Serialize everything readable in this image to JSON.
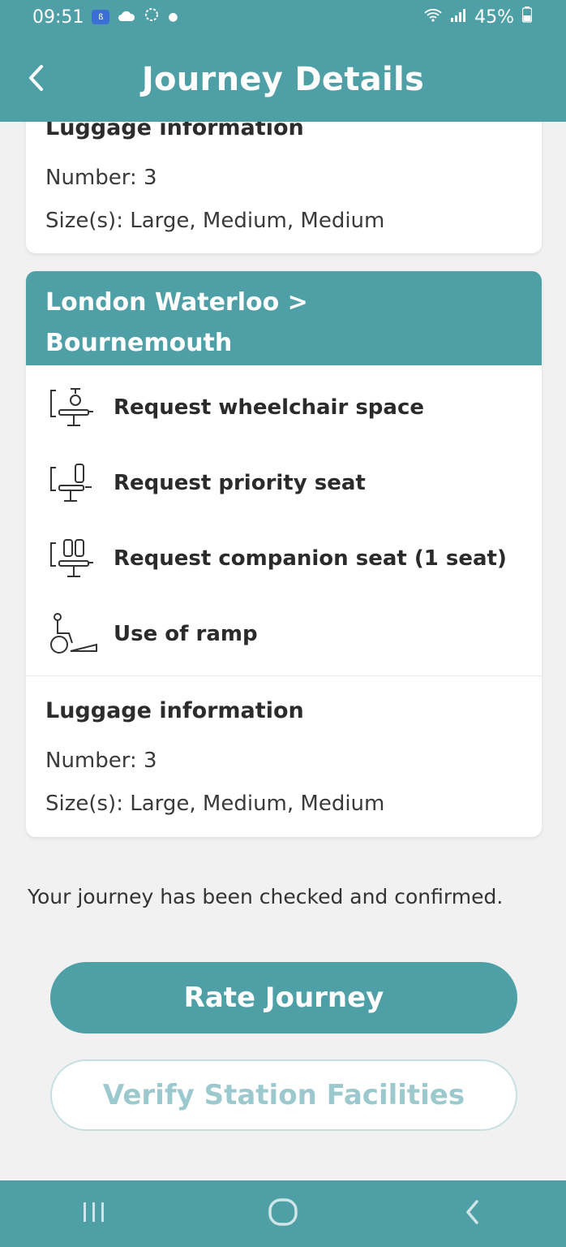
{
  "status_bar": {
    "time": "09:51",
    "app_badge": "ß",
    "battery": "45%"
  },
  "header": {
    "title": "Journey Details",
    "back_icon": "chevron-left-icon"
  },
  "card_previous": {
    "luggage_title": "Luggage information",
    "number": "Number: 3",
    "sizes": "Size(s): Large, Medium, Medium"
  },
  "card_leg": {
    "route_from": "London Waterloo >",
    "route_to": "Bournemouth",
    "services": [
      {
        "label": "Request wheelchair space",
        "icon": "wheelchair-space-icon"
      },
      {
        "label": "Request priority seat",
        "icon": "priority-seat-icon"
      },
      {
        "label": "Request companion seat (1 seat)",
        "icon": "companion-seat-icon"
      },
      {
        "label": "Use of ramp",
        "icon": "ramp-icon"
      }
    ],
    "luggage_title": "Luggage information",
    "number": "Number: 3",
    "sizes": "Size(s): Large, Medium, Medium"
  },
  "confirmation_text": "Your journey has been checked and confirmed.",
  "buttons": {
    "rate": "Rate Journey",
    "verify": "Verify Station Facilities"
  },
  "colors": {
    "teal": "#4f9fa7",
    "background": "#f1f1f1",
    "outline_text": "#9cc9cd"
  }
}
